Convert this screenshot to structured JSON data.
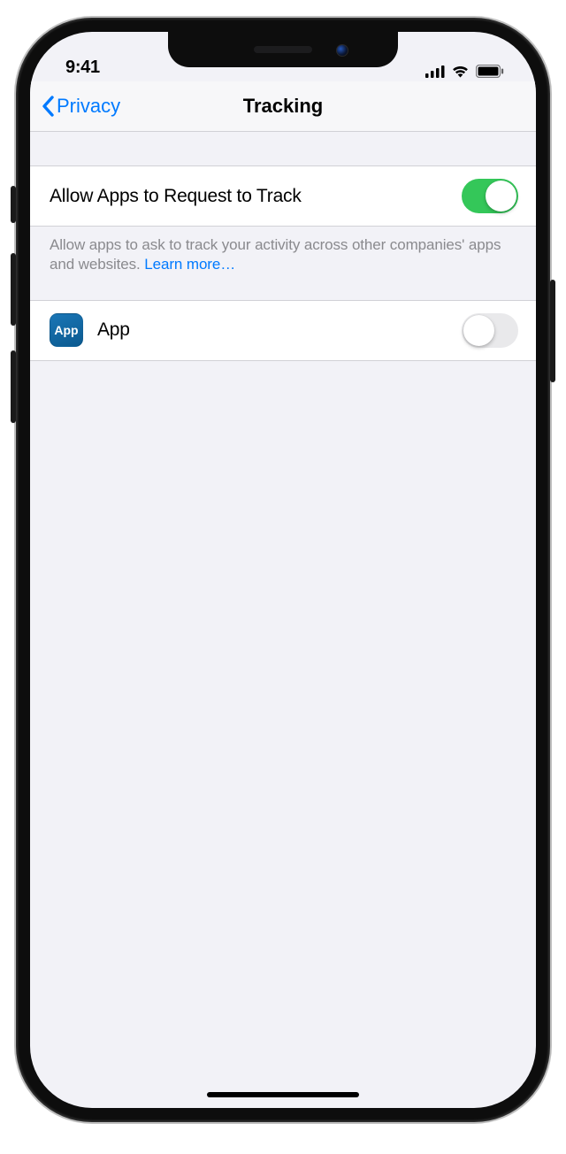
{
  "status": {
    "time": "9:41"
  },
  "nav": {
    "back_label": "Privacy",
    "title": "Tracking"
  },
  "allow": {
    "label": "Allow Apps to Request to Track",
    "description": "Allow apps to ask to track your activity across other companies' apps and websites. ",
    "learn_more": "Learn more…",
    "enabled": true
  },
  "apps": [
    {
      "name": "App",
      "icon_label": "App",
      "enabled": false
    }
  ]
}
